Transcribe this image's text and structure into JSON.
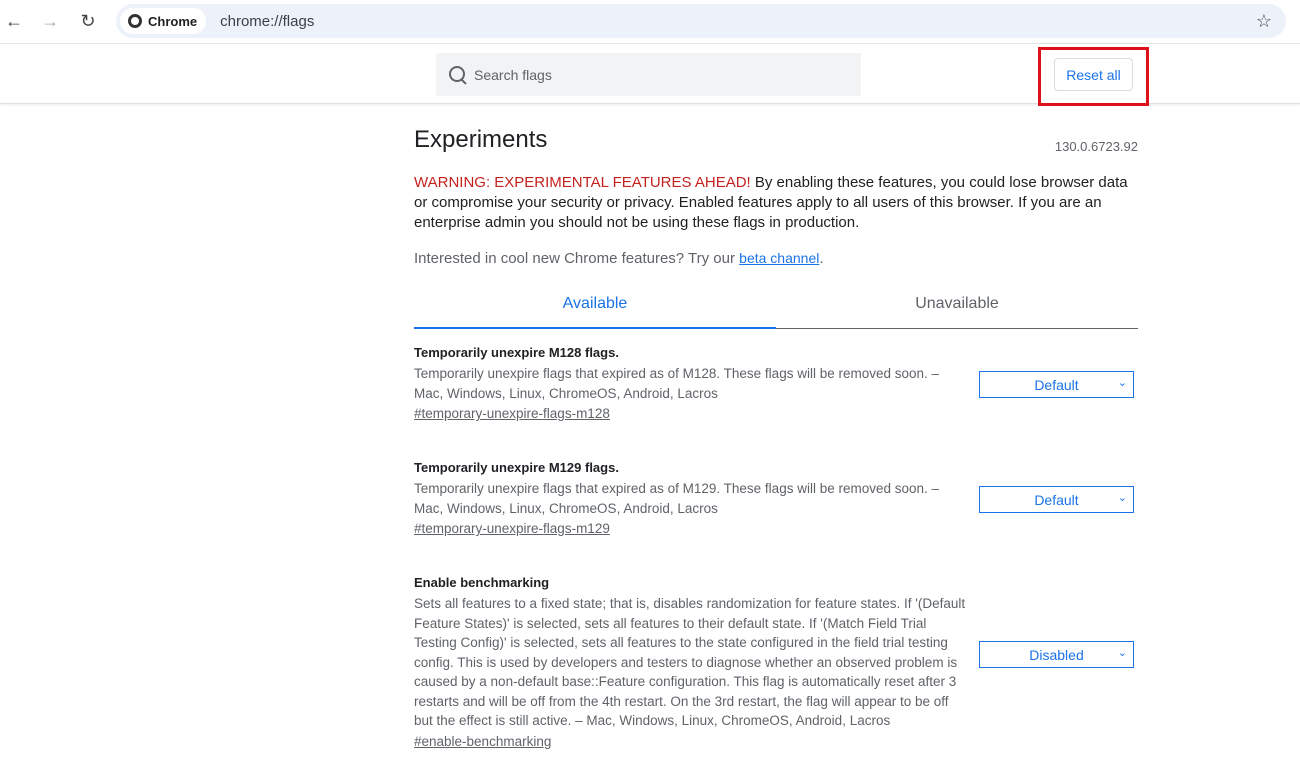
{
  "browser": {
    "chip_label": "Chrome",
    "url": "chrome://flags"
  },
  "header": {
    "search_placeholder": "Search flags",
    "reset_label": "Reset all"
  },
  "main": {
    "title": "Experiments",
    "version": "130.0.6723.92",
    "warning_red": "WARNING: EXPERIMENTAL FEATURES AHEAD!",
    "warning_text": " By enabling these features, you could lose browser data or compromise your security or privacy. Enabled features apply to all users of this browser. If you are an enterprise admin you should not be using these flags in production.",
    "beta_text": "Interested in cool new Chrome features? Try our ",
    "beta_link": "beta channel",
    "beta_end": ".",
    "tabs": [
      {
        "label": "Available",
        "active": true
      },
      {
        "label": "Unavailable",
        "active": false
      }
    ],
    "flags": [
      {
        "title": "Temporarily unexpire M128 flags.",
        "description": "Temporarily unexpire flags that expired as of M128. These flags will be removed soon. – Mac, Windows, Linux, ChromeOS, Android, Lacros",
        "link": "#temporary-unexpire-flags-m128",
        "value": "Default"
      },
      {
        "title": "Temporarily unexpire M129 flags.",
        "description": "Temporarily unexpire flags that expired as of M129. These flags will be removed soon. – Mac, Windows, Linux, ChromeOS, Android, Lacros",
        "link": "#temporary-unexpire-flags-m129",
        "value": "Default"
      },
      {
        "title": "Enable benchmarking",
        "description": "Sets all features to a fixed state; that is, disables randomization for feature states. If '(Default Feature States)' is selected, sets all features to their default state. If '(Match Field Trial Testing Config)' is selected, sets all features to the state configured in the field trial testing config. This is used by developers and testers to diagnose whether an observed problem is caused by a non-default base::Feature configuration. This flag is automatically reset after 3 restarts and will be off from the 4th restart. On the 3rd restart, the flag will appear to be off but the effect is still active. – Mac, Windows, Linux, ChromeOS, Android, Lacros",
        "link": "#enable-benchmarking",
        "value": "Disabled"
      }
    ]
  },
  "colors": {
    "accent": "#1a73e8",
    "warning": "#c5221f",
    "highlight": "#e0101a"
  }
}
